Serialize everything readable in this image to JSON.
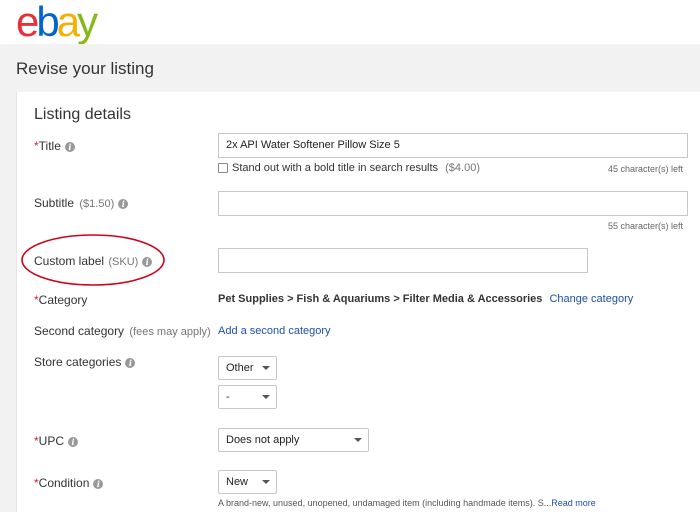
{
  "logo": {
    "letters": [
      "e",
      "b",
      "a",
      "y"
    ],
    "colors": [
      "#e53238",
      "#0064d2",
      "#f5af02",
      "#86b817"
    ]
  },
  "page": {
    "title": "Revise your listing"
  },
  "section": {
    "title": "Listing details"
  },
  "fields": {
    "title": {
      "required_mark": "*",
      "label": "Title",
      "value": "2x API Water Softener Pillow Size 5",
      "chars_left": "45 character(s) left"
    },
    "bold_title": {
      "label": "Stand out with a bold title in search results",
      "price": "($4.00)"
    },
    "subtitle": {
      "label": "Subtitle",
      "price": "($1.50)",
      "value": "",
      "chars_left": "55 character(s) left"
    },
    "custom_label": {
      "label": "Custom label",
      "suffix": "(SKU)",
      "value": ""
    },
    "category": {
      "required_mark": "*",
      "label": "Category",
      "path": "Pet Supplies > Fish & Aquariums > Filter Media & Accessories",
      "change_link": "Change category"
    },
    "second_category": {
      "label": "Second category",
      "note": "(fees may apply)",
      "add_link": "Add a second category"
    },
    "store_categories": {
      "label": "Store categories",
      "first_value": "Other",
      "second_value": "-"
    },
    "upc": {
      "required_mark": "*",
      "label": "UPC",
      "value": "Does not apply"
    },
    "condition": {
      "required_mark": "*",
      "label": "Condition",
      "value": "New",
      "description": "A brand-new, unused, unopened, undamaged item (including handmade items). S...",
      "read_more": "Read more"
    }
  },
  "icons": {
    "info": "i",
    "annotation_color": "#d0021b"
  }
}
